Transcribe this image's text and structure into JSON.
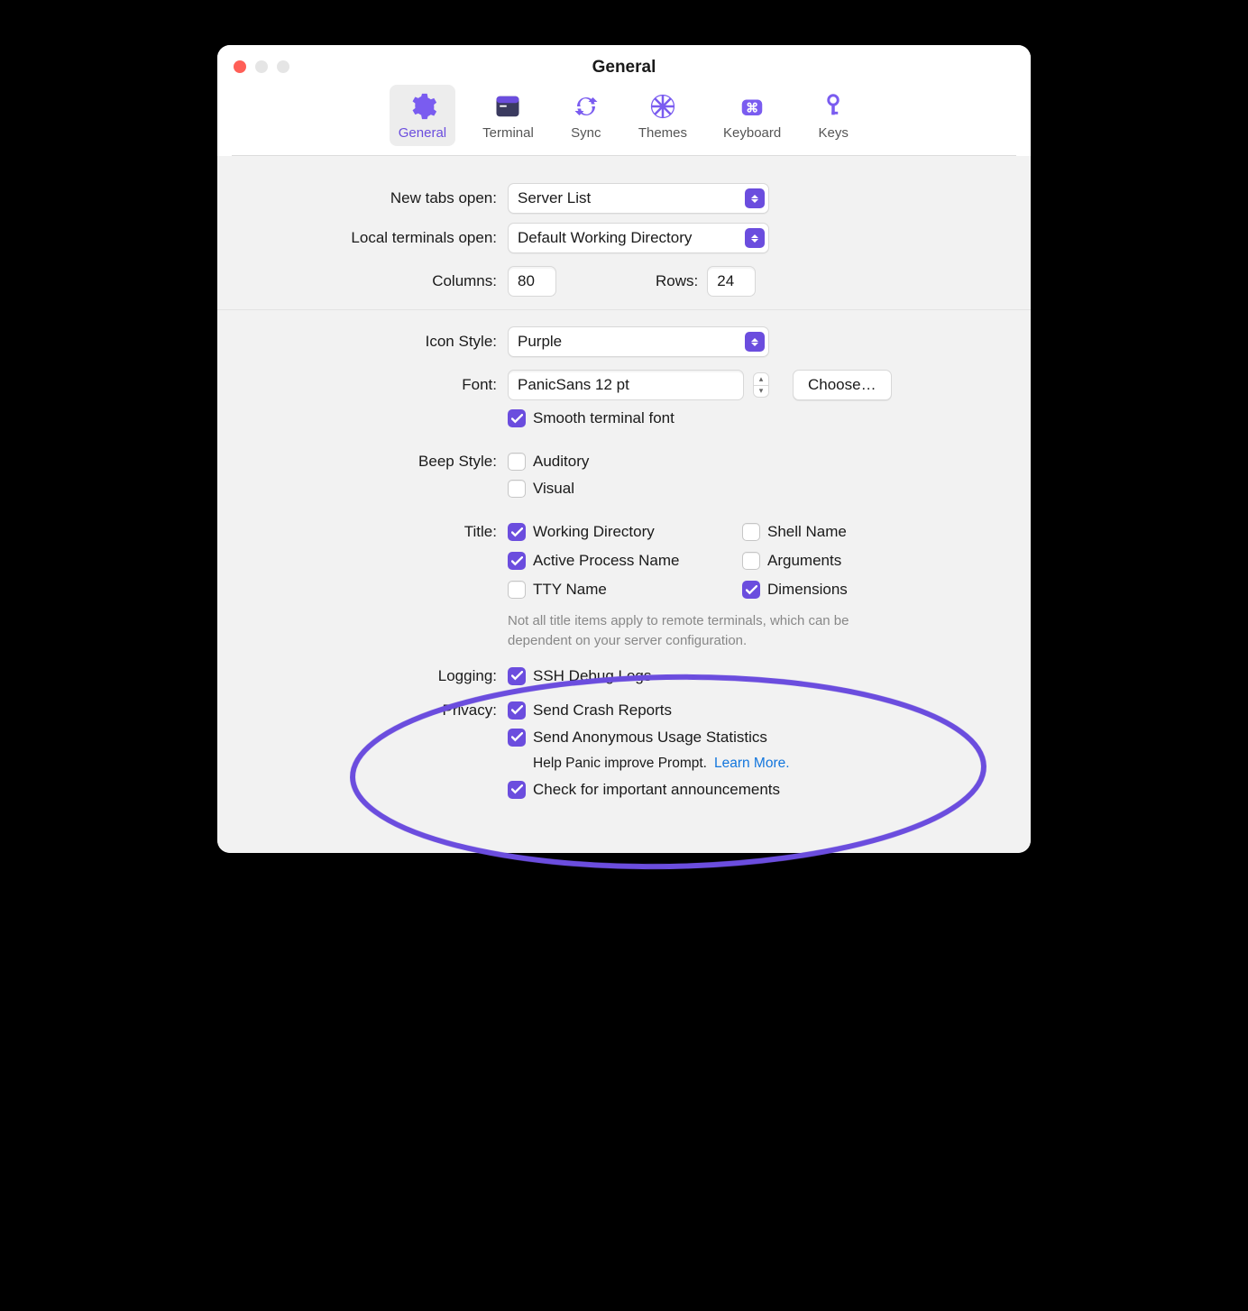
{
  "window_title": "General",
  "tabs": {
    "general": "General",
    "terminal": "Terminal",
    "sync": "Sync",
    "themes": "Themes",
    "keyboard": "Keyboard",
    "keys": "Keys"
  },
  "labels": {
    "new_tabs": "New tabs open:",
    "local_terminals": "Local terminals open:",
    "columns": "Columns:",
    "rows": "Rows:",
    "icon_style": "Icon Style:",
    "font": "Font:",
    "beep_style": "Beep Style:",
    "title": "Title:",
    "logging": "Logging:",
    "privacy": "Privacy:"
  },
  "values": {
    "new_tabs": "Server List",
    "local_terminals": "Default Working Directory",
    "columns": "80",
    "rows": "24",
    "icon_style": "Purple",
    "font": "PanicSans 12 pt",
    "choose": "Choose…"
  },
  "checks": {
    "smooth_font": "Smooth terminal font",
    "auditory": "Auditory",
    "visual": "Visual",
    "working_dir": "Working Directory",
    "shell_name": "Shell Name",
    "active_process": "Active Process Name",
    "arguments": "Arguments",
    "tty_name": "TTY Name",
    "dimensions": "Dimensions",
    "ssh_debug": "SSH Debug Logs",
    "send_crash": "Send Crash Reports",
    "send_anon": "Send Anonymous Usage Statistics",
    "check_announce": "Check for important announcements"
  },
  "notes": {
    "title_note": "Not all title items apply to remote terminals, which can be dependent on your server configuration.",
    "help_panic": "Help Panic improve Prompt.",
    "learn_more": "Learn More."
  }
}
